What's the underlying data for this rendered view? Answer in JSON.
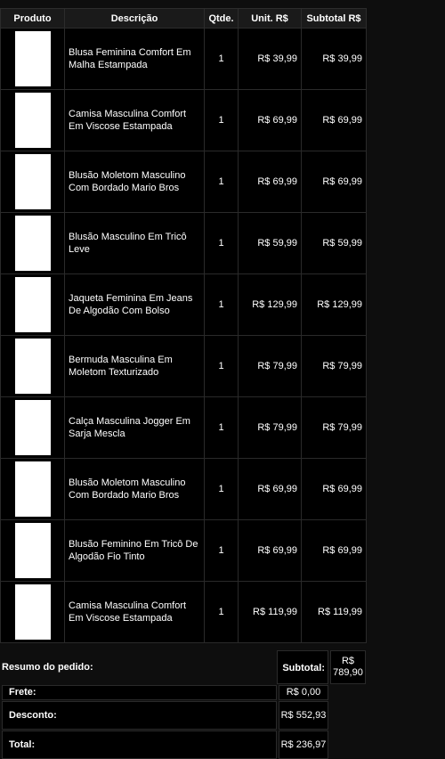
{
  "headers": {
    "product": "Produto",
    "description": "Descrição",
    "qty": "Qtde.",
    "unit": "Unit. R$",
    "subtotal": "Subtotal R$"
  },
  "items": [
    {
      "desc": "Blusa Feminina Comfort Em Malha Estampada",
      "qty": "1",
      "unit": "R$ 39,99",
      "subtotal": "R$ 39,99"
    },
    {
      "desc": "Camisa Masculina Comfort Em Viscose Estampada",
      "qty": "1",
      "unit": "R$ 69,99",
      "subtotal": "R$ 69,99"
    },
    {
      "desc": "Blusão Moletom Masculino Com Bordado Mario Bros",
      "qty": "1",
      "unit": "R$ 69,99",
      "subtotal": "R$ 69,99"
    },
    {
      "desc": "Blusão Masculino Em Tricô Leve",
      "qty": "1",
      "unit": "R$ 59,99",
      "subtotal": "R$ 59,99"
    },
    {
      "desc": "Jaqueta Feminina Em Jeans De Algodão Com Bolso",
      "qty": "1",
      "unit": "R$ 129,99",
      "subtotal": "R$ 129,99"
    },
    {
      "desc": "Bermuda Masculina Em Moletom Texturizado",
      "qty": "1",
      "unit": "R$ 79,99",
      "subtotal": "R$ 79,99"
    },
    {
      "desc": "Calça Masculina Jogger Em Sarja Mescla",
      "qty": "1",
      "unit": "R$ 79,99",
      "subtotal": "R$ 79,99"
    },
    {
      "desc": "Blusão Moletom Masculino Com Bordado Mario Bros",
      "qty": "1",
      "unit": "R$ 69,99",
      "subtotal": "R$ 69,99"
    },
    {
      "desc": "Blusão Feminino Em Tricô De Algodão Fio Tinto",
      "qty": "1",
      "unit": "R$ 69,99",
      "subtotal": "R$ 69,99"
    },
    {
      "desc": "Camisa Masculina Comfort Em Viscose Estampada",
      "qty": "1",
      "unit": "R$ 119,99",
      "subtotal": "R$ 119,99"
    }
  ],
  "summary": {
    "title": "Resumo do pedido:",
    "subtotal_label": "Subtotal:",
    "subtotal_value": "R$ 789,90",
    "shipping_label": "Frete:",
    "shipping_value": "R$ 0,00",
    "discount_label": "Desconto:",
    "discount_value": "R$ 552,93",
    "total_label": "Total:",
    "total_value": "R$ 236,97"
  }
}
